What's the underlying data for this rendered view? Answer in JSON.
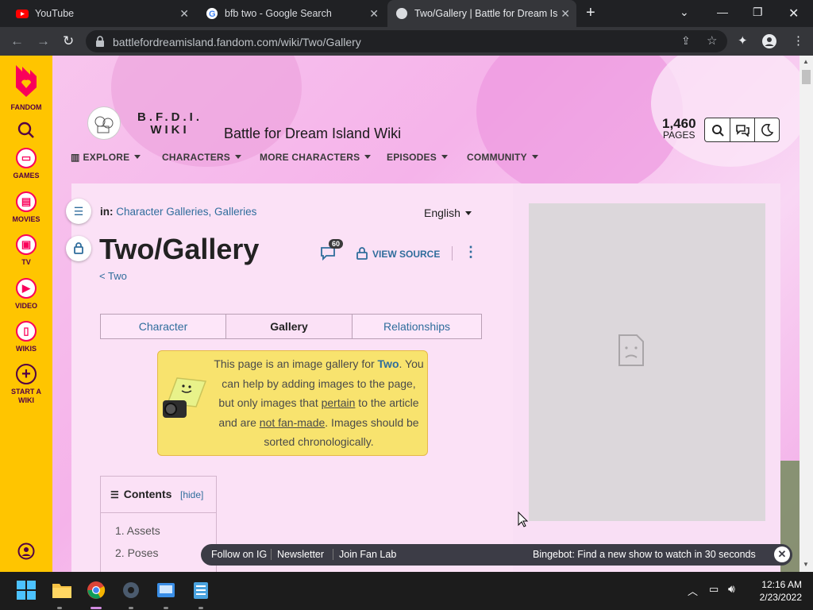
{
  "browser": {
    "tabs": [
      {
        "title": "YouTube",
        "icon": "youtube-icon"
      },
      {
        "title": "bfb two - Google Search",
        "icon": "google-icon"
      },
      {
        "title": "Two/Gallery | Battle for Dream Isl",
        "icon": "fandom-icon"
      }
    ],
    "url": "battlefordreamisland.fandom.com/wiki/Two/Gallery"
  },
  "rail": {
    "brand": "FANDOM",
    "items": [
      {
        "label": "GAMES",
        "icon": "gamepad-icon"
      },
      {
        "label": "MOVIES",
        "icon": "film-icon"
      },
      {
        "label": "TV",
        "icon": "tv-icon"
      },
      {
        "label": "VIDEO",
        "icon": "play-icon"
      },
      {
        "label": "WIKIS",
        "icon": "book-icon"
      },
      {
        "label": "START A WIKI",
        "icon": "plus-circle-icon"
      }
    ]
  },
  "wiki": {
    "logo_line1": "B.F.D.I.",
    "logo_line2": "WIKI",
    "name": "Battle for Dream Island Wiki",
    "page_count": "1,460",
    "page_count_label": "PAGES",
    "nav": [
      "EXPLORE",
      "CHARACTERS",
      "MORE CHARACTERS",
      "EPISODES",
      "COMMUNITY"
    ]
  },
  "article": {
    "categories_prefix": "in:",
    "categories": "Character Galleries, Galleries",
    "language": "English",
    "title": "Two/Gallery",
    "comment_count": "60",
    "view_source": "VIEW SOURCE",
    "back_link": "< Two",
    "tabs": [
      "Character",
      "Gallery",
      "Relationships"
    ],
    "active_tab": "Gallery",
    "notice": {
      "pre": "This page is an image gallery for ",
      "bold": "Two",
      "mid1": ". You can help by adding images to the page, but only images that ",
      "link1": "pertain",
      "mid2": " to the article and are ",
      "link2": "not fan-made",
      "post": ". Images should be sorted chronologically."
    },
    "toc": {
      "title": "Contents",
      "hide": "[hide]",
      "items": [
        "1. Assets",
        "2. Poses"
      ]
    }
  },
  "bottom_bar": {
    "links": [
      "Follow on IG",
      "Newsletter",
      "Join Fan Lab"
    ],
    "message": "Bingebot: Find a new show to watch in 30 seconds"
  },
  "taskbar": {
    "time": "12:16 AM",
    "date": "2/23/2022"
  }
}
